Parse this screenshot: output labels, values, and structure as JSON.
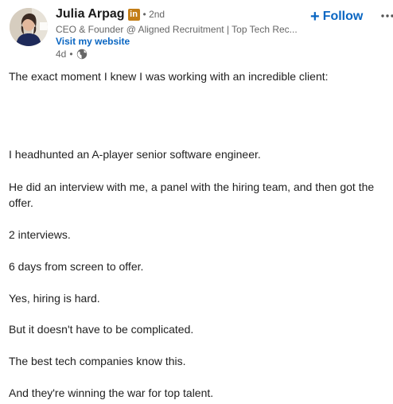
{
  "author": {
    "name": "Julia Arpag",
    "badge": "in",
    "degree": "• 2nd",
    "headline": "CEO & Founder @ Aligned Recruitment | Top Tech Rec...",
    "website_label": "Visit my website",
    "time": "4d",
    "time_separator": "•",
    "visibility_icon": "globe-icon"
  },
  "actions": {
    "follow_plus": "+",
    "follow_label": "Follow",
    "more_icon": "more-horizontal-icon"
  },
  "post": {
    "paragraphs": [
      "The exact moment I knew I was working with an incredible client:",
      "I headhunted an A-player senior software engineer.",
      "He did an interview with me, a panel with the hiring team, and then got the offer.",
      "2 interviews.",
      "6 days from screen to offer.",
      "Yes, hiring is hard.",
      "But it doesn't have to be complicated.",
      "The best tech companies know this.",
      "And they're winning the war for top talent."
    ]
  },
  "colors": {
    "link_blue": "#0a66c2",
    "badge_gold": "#c37d16",
    "secondary_text": "#666666"
  }
}
